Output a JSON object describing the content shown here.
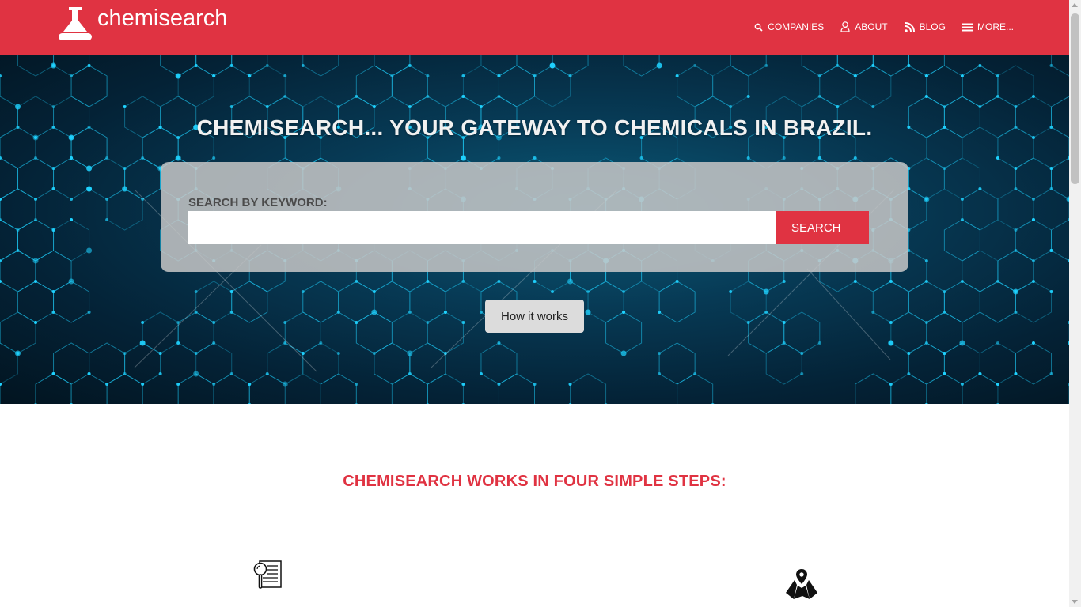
{
  "header": {
    "brand": "chemisearch",
    "nav": [
      {
        "label": "COMPANIES",
        "icon": "search-icon"
      },
      {
        "label": "ABOUT",
        "icon": "user-icon"
      },
      {
        "label": "BLOG",
        "icon": "rss-icon"
      },
      {
        "label": "MORE...",
        "icon": "menu-icon"
      }
    ]
  },
  "hero": {
    "title": "CHEMISEARCH... YOUR GATEWAY TO CHEMICALS IN BRAZIL.",
    "search": {
      "label": "SEARCH BY KEYWORD:",
      "input_value": "",
      "placeholder": "",
      "button_label": "SEARCH"
    },
    "how_it_works_label": "How it works"
  },
  "steps": {
    "heading": "CHEMISEARCH WORKS IN FOUR SIMPLE STEPS:",
    "visible_icons": [
      "document-search-icon",
      "map-location-icon"
    ]
  },
  "colors": {
    "brand_red": "#e03342",
    "hero_dark": "#042236",
    "hex_glow": "#1fd2ff"
  }
}
